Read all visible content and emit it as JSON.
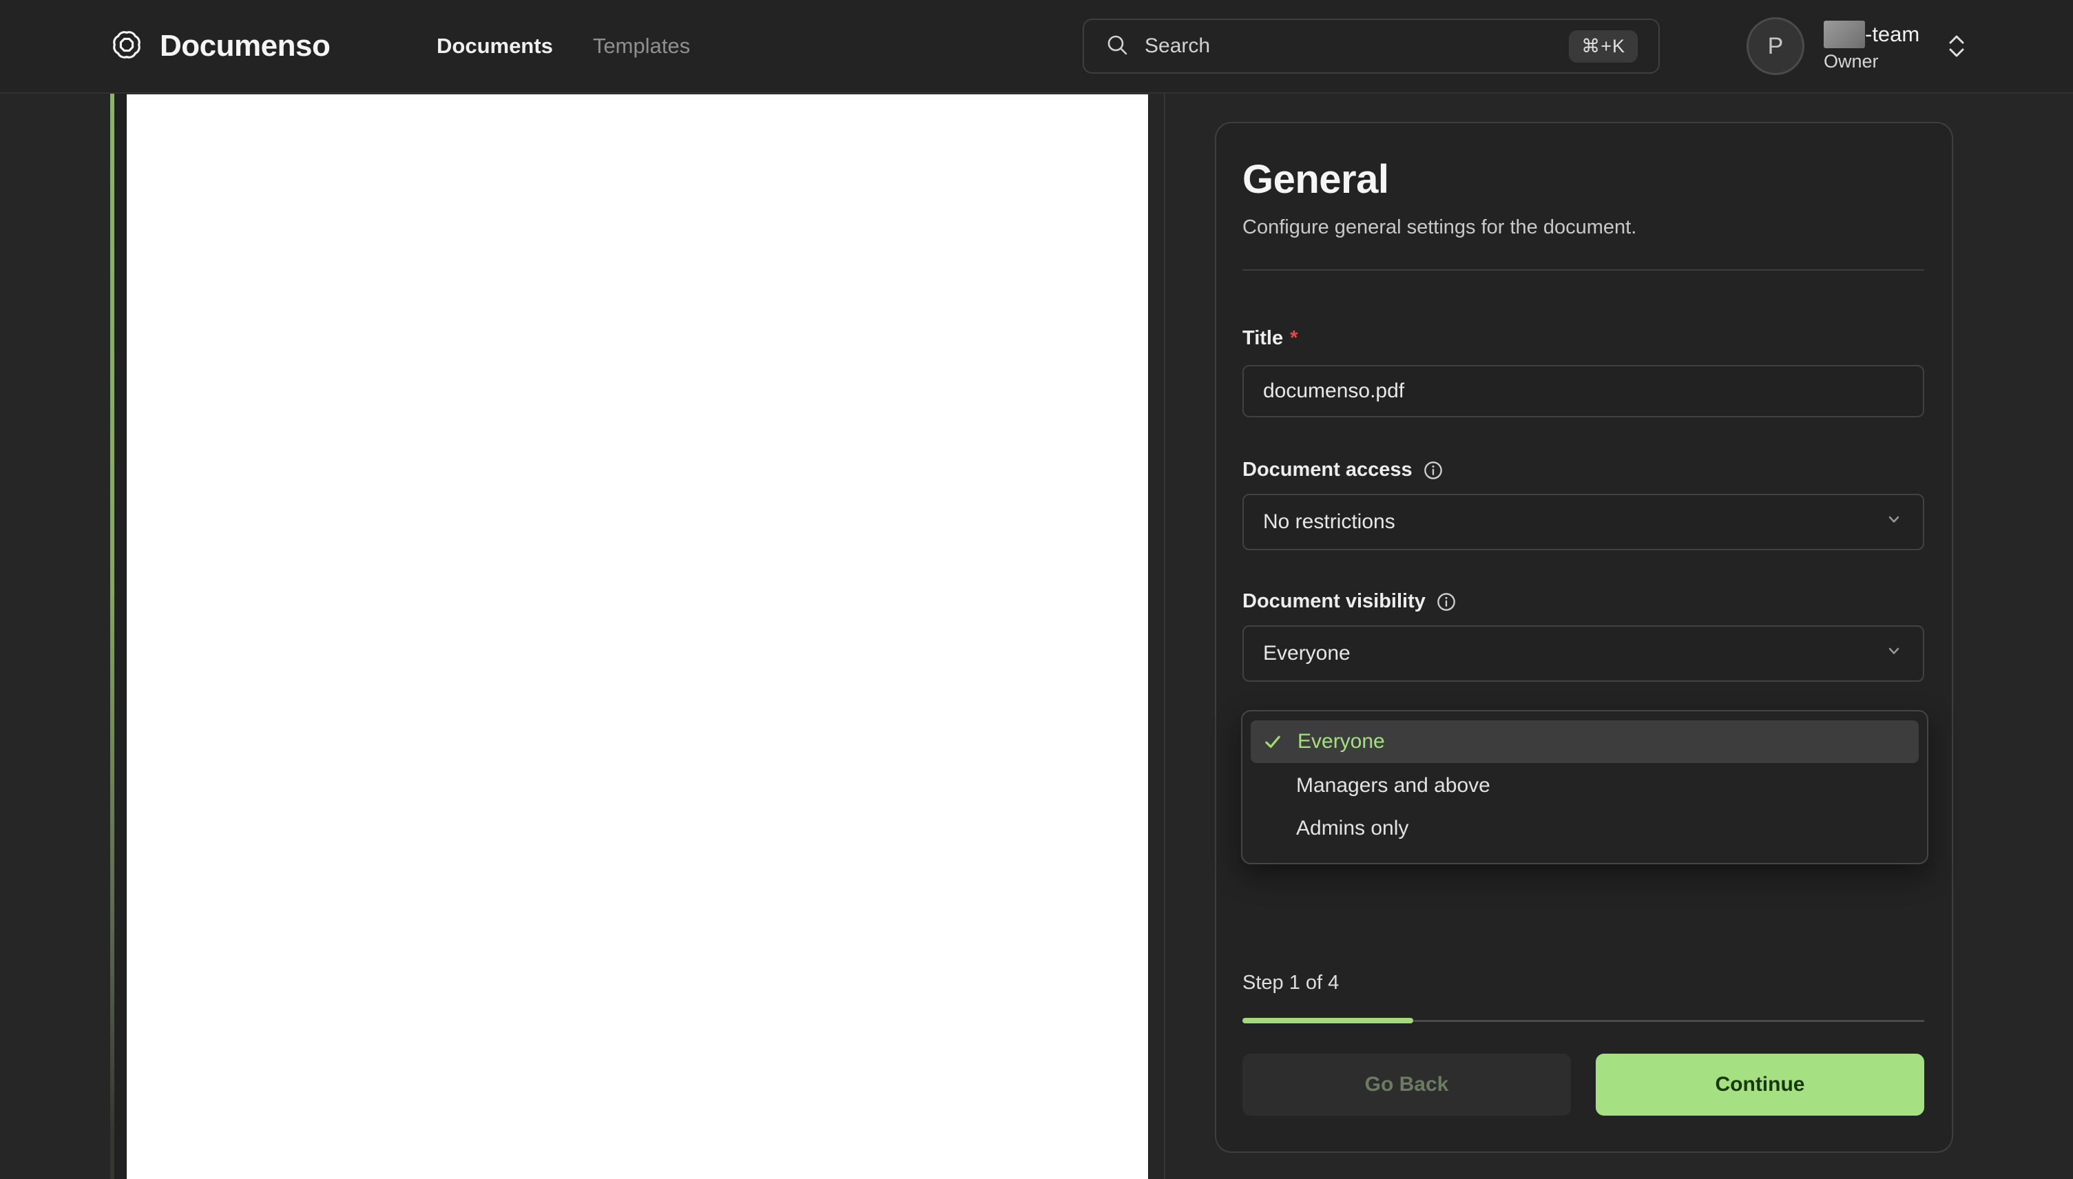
{
  "navbar": {
    "brand": "Documenso",
    "links": [
      {
        "label": "Documents",
        "active": true
      },
      {
        "label": "Templates",
        "active": false
      }
    ],
    "search": {
      "placeholder": "Search",
      "shortcut": "⌘+K"
    },
    "profile": {
      "avatar_initial": "P",
      "team_name_suffix": "-team",
      "role": "Owner"
    }
  },
  "panel": {
    "title": "General",
    "subtitle": "Configure general settings for the document.",
    "fields": {
      "title": {
        "label": "Title",
        "required_marker": "*",
        "value": "documenso.pdf"
      },
      "access": {
        "label": "Document access",
        "value": "No restrictions"
      },
      "visibility": {
        "label": "Document visibility",
        "value": "Everyone"
      }
    },
    "dropdown": {
      "options": [
        {
          "label": "Everyone",
          "selected": true
        },
        {
          "label": "Managers and above",
          "selected": false
        },
        {
          "label": "Admins only",
          "selected": false
        }
      ]
    },
    "step": {
      "text": "Step 1 of 4",
      "progress_percent": 25
    },
    "buttons": {
      "back": "Go Back",
      "continue": "Continue"
    }
  },
  "colors": {
    "accent_green": "#a3e17f",
    "progress_green": "#a3db7a",
    "rail_green": "#84a866",
    "continue_bg": "#a5e183",
    "continue_text": "#17380f",
    "goback_text": "#6b7c61",
    "required_red": "#e5484d",
    "background": "#262626",
    "panel_bg": "#232323"
  }
}
